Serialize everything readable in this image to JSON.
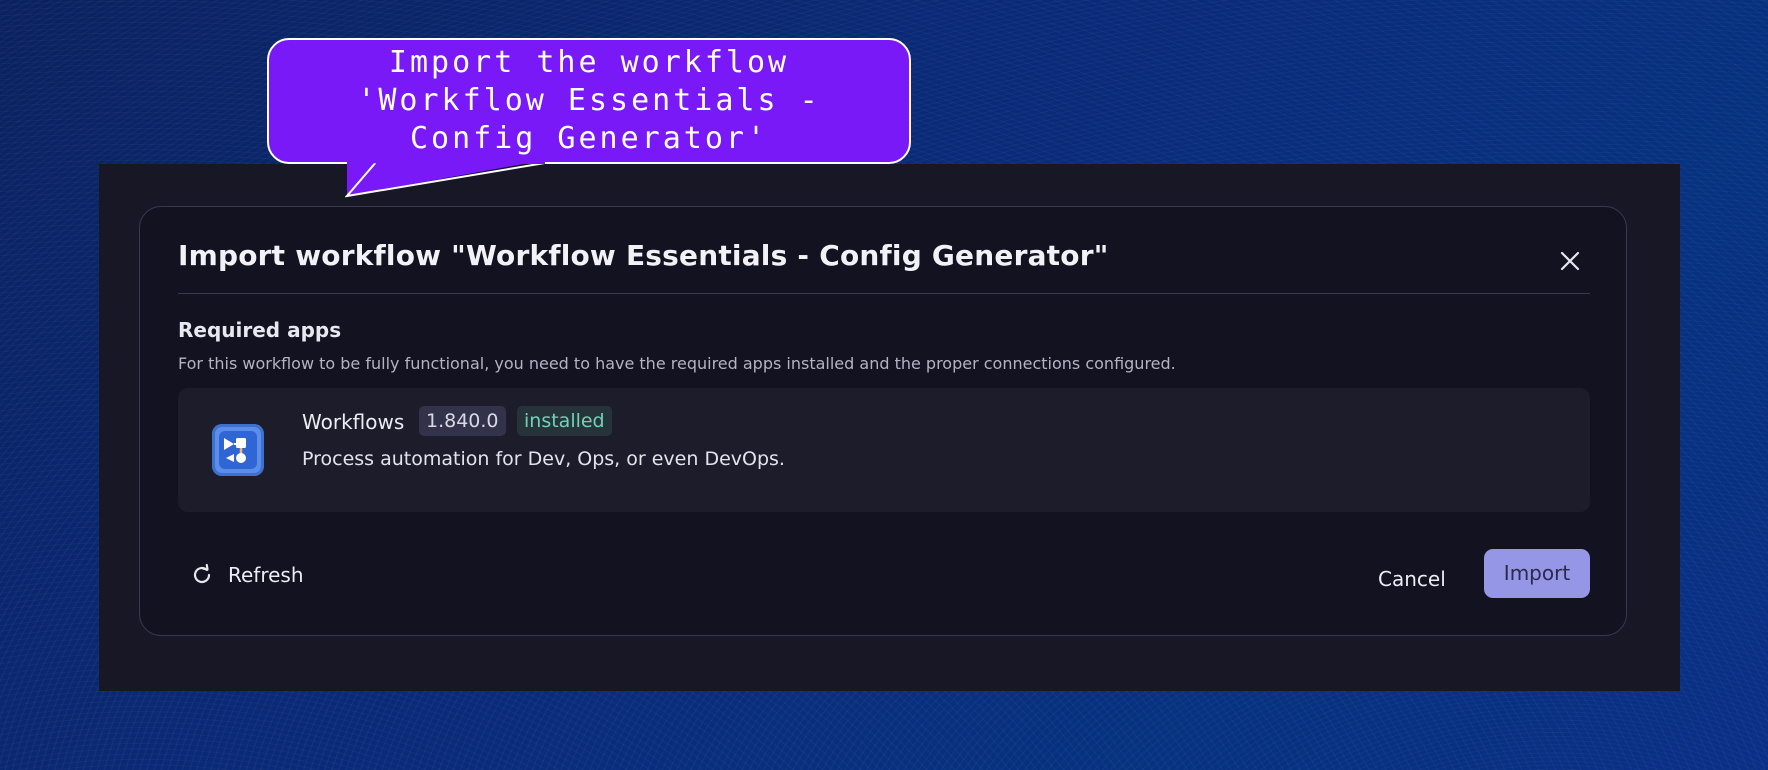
{
  "callout": {
    "text": "Import the workflow 'Workflow Essentials - Config Generator'"
  },
  "dialog": {
    "title": "Import workflow \"Workflow Essentials - Config Generator\"",
    "section_heading": "Required apps",
    "section_description": "For this workflow to be fully functional, you need to have the required apps installed and the proper connections configured.",
    "app": {
      "name": "Workflows",
      "version": "1.840.0",
      "status": "installed",
      "description": "Process automation for Dev, Ops, or even DevOps.",
      "icon": "workflows-app-icon"
    },
    "buttons": {
      "refresh": "Refresh",
      "cancel": "Cancel",
      "import": "Import"
    },
    "icons": {
      "close": "close-icon",
      "refresh": "refresh-icon"
    }
  },
  "colors": {
    "callout": "#7a19f7",
    "dialog_bg": "#121220",
    "import_button": "#9596e6",
    "installed_text": "#6ed3b7"
  }
}
